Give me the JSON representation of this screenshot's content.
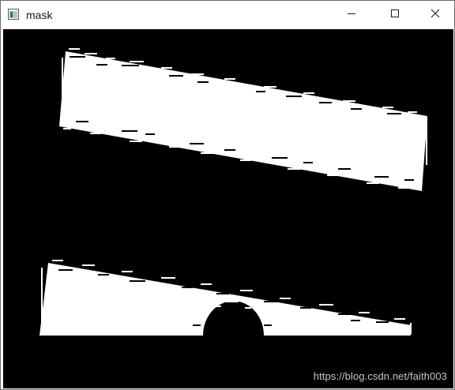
{
  "window": {
    "title": "mask",
    "icon": "app-window-icon",
    "controls": [
      "minimize-icon",
      "maximize-icon",
      "close-icon"
    ]
  },
  "image": {
    "background_color": "#000000",
    "foreground_color": "#ffffff",
    "watermark": "https://blog.csdn.net/faith003"
  }
}
